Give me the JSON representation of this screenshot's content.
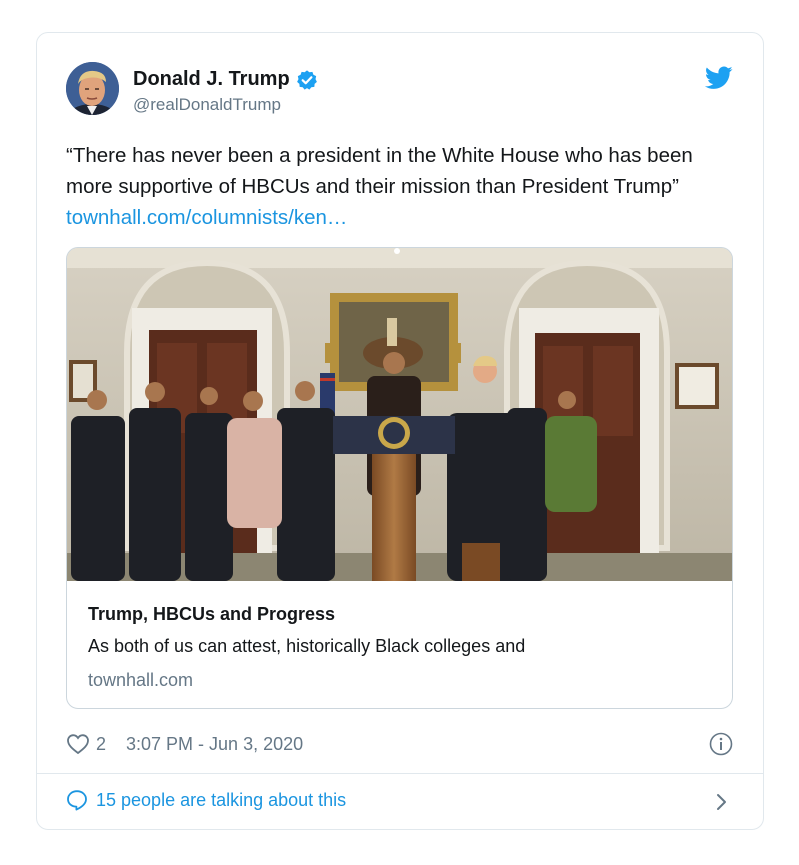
{
  "author": {
    "name": "Donald J. Trump",
    "handle": "@realDonaldTrump",
    "verified": true
  },
  "tweet": {
    "text": "“There has never been a president in the White House who has been more supportive of HBCUs and their mission than President Trump”",
    "link_text": "townhall.com/columnists/ken…"
  },
  "card": {
    "title": "Trump, HBCUs and Progress",
    "description": "As both of us can attest, historically Black colleges and",
    "domain": "townhall.com"
  },
  "meta": {
    "likes": "2",
    "timestamp": "3:07 PM - Jun 3, 2020"
  },
  "conversation": {
    "label": "15 people are talking about this"
  },
  "icons": {
    "verified": "verified-badge-icon",
    "logo": "twitter-bird-icon",
    "like": "heart-icon",
    "info": "info-icon",
    "reply": "comment-bubble-icon",
    "expand": "chevron-right-icon"
  },
  "colors": {
    "link": "#1b95e0",
    "verified": "#1da1f2",
    "secondary_text": "#657786",
    "border": "#e1e8ed"
  }
}
